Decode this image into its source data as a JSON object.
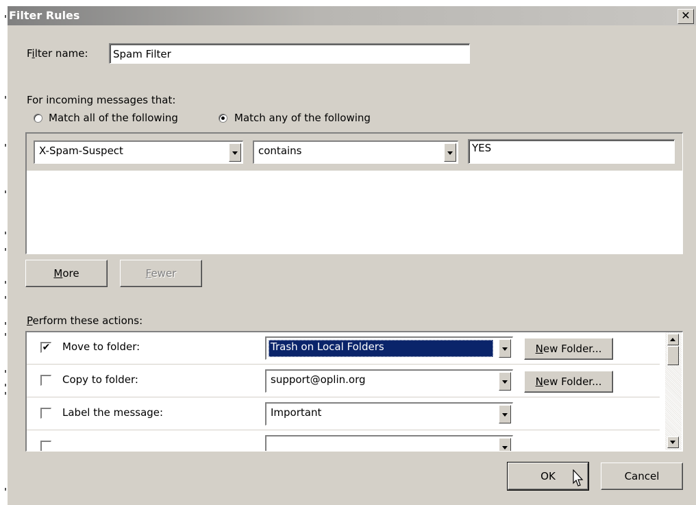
{
  "window": {
    "title": "Filter Rules",
    "close_label": "✕"
  },
  "filter_name": {
    "label_pre": "F",
    "label_u": "i",
    "label_post": "lter name:",
    "value": "Spam Filter"
  },
  "incoming": {
    "label": "For incoming messages that:",
    "match_all": {
      "label": "Match all of the following",
      "selected": false
    },
    "match_any": {
      "label": "Match any of the following",
      "selected": true
    }
  },
  "condition": {
    "header": "X-Spam-Suspect",
    "operator": "contains",
    "value": "YES"
  },
  "buttons": {
    "more": {
      "u": "M",
      "rest": "ore"
    },
    "fewer": {
      "u": "F",
      "rest": "ewer"
    },
    "ok": "OK",
    "cancel": "Cancel"
  },
  "actions": {
    "label_u": "P",
    "label_rest": "erform these actions:",
    "rows": [
      {
        "checked": true,
        "label": "Move to folder:",
        "value": "Trash on Local Folders",
        "new_folder": {
          "u": "N",
          "rest": "ew Folder..."
        }
      },
      {
        "checked": false,
        "label": "Copy to folder:",
        "value": "support@oplin.org",
        "new_folder": {
          "u": "N",
          "rest": "ew Folder..."
        }
      },
      {
        "checked": false,
        "label": "Label the message:",
        "value": "Important"
      }
    ]
  },
  "icons": {
    "checkmark": "✔"
  }
}
